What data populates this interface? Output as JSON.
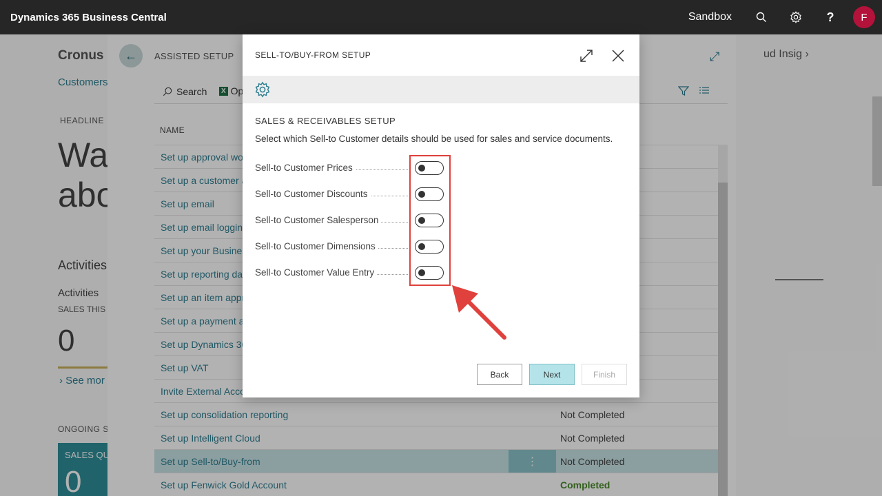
{
  "topbar": {
    "brand": "Dynamics 365 Business Central",
    "environment": "Sandbox",
    "avatar_initial": "F"
  },
  "background": {
    "company": "Cronus I",
    "customers_link": "Customers",
    "headline_label": "HEADLINE",
    "headline_line1": "Wa",
    "headline_line2": "abo",
    "activities": "Activities",
    "activities_sub": "Activities",
    "sales_this": "SALES THIS",
    "sales_value": "0",
    "see_more": "See mor",
    "ongoing": "ONGOING S",
    "tile_title": "SALES QU",
    "tile_value": "0",
    "right_text": "ud Insig"
  },
  "assisted_setup": {
    "title": "ASSISTED SETUP",
    "search_label": "Search",
    "open_label": "Op",
    "name_header": "NAME",
    "rows": [
      {
        "name": "Set up approval wo",
        "status": ""
      },
      {
        "name": "Set up a customer a",
        "status": ""
      },
      {
        "name": "Set up email",
        "status": ""
      },
      {
        "name": "Set up email loggin",
        "status": ""
      },
      {
        "name": "Set up your Busines",
        "status": ""
      },
      {
        "name": "Set up reporting da",
        "status": ""
      },
      {
        "name": "Set up an item appr",
        "status": ""
      },
      {
        "name": "Set up a payment a",
        "status": ""
      },
      {
        "name": "Set up Dynamics 36",
        "status": ""
      },
      {
        "name": "Set up VAT",
        "status": ""
      },
      {
        "name": "Invite External Acco",
        "status": ""
      },
      {
        "name": "Set up consolidation reporting",
        "status": "Not Completed"
      },
      {
        "name": "Set up Intelligent Cloud",
        "status": "Not Completed"
      },
      {
        "name": "Set up Sell-to/Buy-from",
        "status": "Not Completed"
      },
      {
        "name": "Set up Fenwick Gold Account",
        "status": "Completed"
      }
    ]
  },
  "dialog": {
    "title": "SELL-TO/BUY-FROM SETUP",
    "section": "SALES & RECEIVABLES SETUP",
    "description": "Select which Sell-to Customer details should be used for sales and service documents.",
    "fields": [
      {
        "label": "Sell-to Customer Prices",
        "on": false
      },
      {
        "label": "Sell-to Customer Discounts",
        "on": false
      },
      {
        "label": "Sell-to Customer Salesperson",
        "on": false
      },
      {
        "label": "Sell-to Customer Dimensions",
        "on": false
      },
      {
        "label": "Sell-to Customer Value Entry",
        "on": false
      }
    ],
    "buttons": {
      "back": "Back",
      "next": "Next",
      "finish": "Finish"
    }
  },
  "colors": {
    "accent": "#2f7f91",
    "highlight": "#e0413c",
    "topbar": "#262626"
  }
}
